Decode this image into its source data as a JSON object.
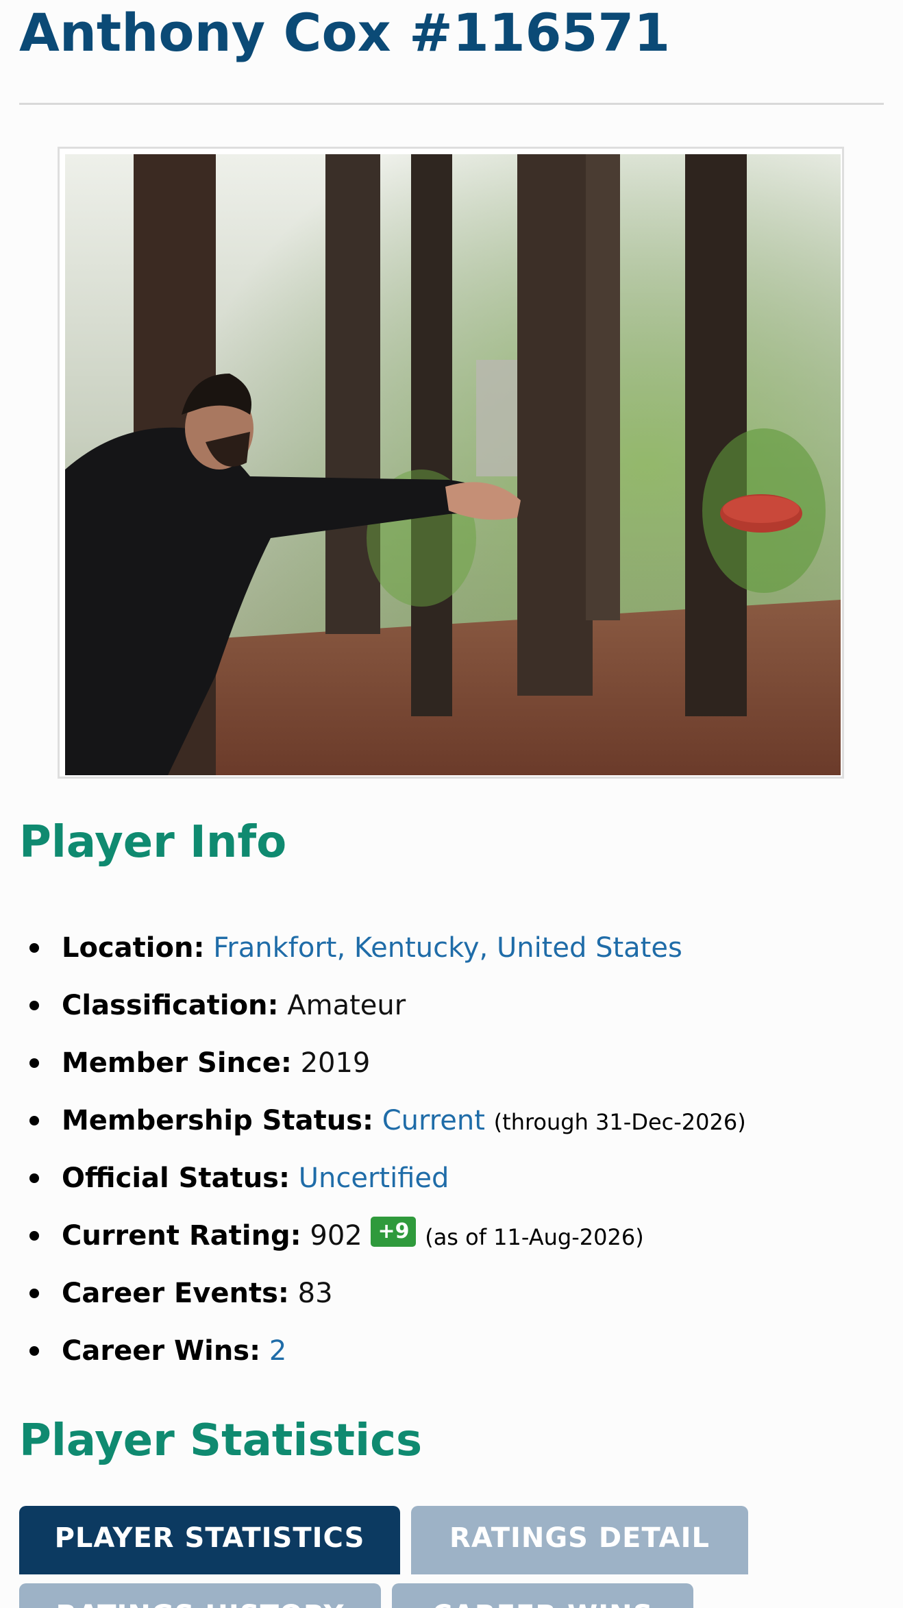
{
  "player": {
    "title": "Anthony Cox #116571"
  },
  "photo": {
    "icon": "player-photo"
  },
  "player_info": {
    "heading": "Player Info",
    "location_label": "Location:",
    "location_value": "Frankfort, Kentucky, United States",
    "classification_label": "Classification:",
    "classification_value": "Amateur",
    "member_since_label": "Member Since:",
    "member_since_value": "2019",
    "membership_status_label": "Membership Status:",
    "membership_status_value": "Current",
    "membership_status_note": "(through 31-Dec-2026)",
    "official_status_label": "Official Status:",
    "official_status_value": "Uncertified",
    "current_rating_label": "Current Rating:",
    "current_rating_value": "902",
    "rating_change": "+9",
    "rating_note": "(as of 11-Aug-2026)",
    "career_events_label": "Career Events:",
    "career_events_value": "83",
    "career_wins_label": "Career Wins:",
    "career_wins_value": "2"
  },
  "statistics": {
    "heading": "Player Statistics",
    "tabs": [
      {
        "label": "PLAYER STATISTICS",
        "active": true
      },
      {
        "label": "RATINGS DETAIL",
        "active": false
      },
      {
        "label": "RATINGS HISTORY",
        "active": false
      },
      {
        "label": "CAREER WINS",
        "active": false
      }
    ]
  },
  "colors": {
    "title": "#0b4a76",
    "section_heading": "#0f8a70",
    "link": "#1f6ca8",
    "badge": "#2f9a3c",
    "tab_active": "#0c3a61",
    "tab_inactive": "#9db2c6"
  }
}
